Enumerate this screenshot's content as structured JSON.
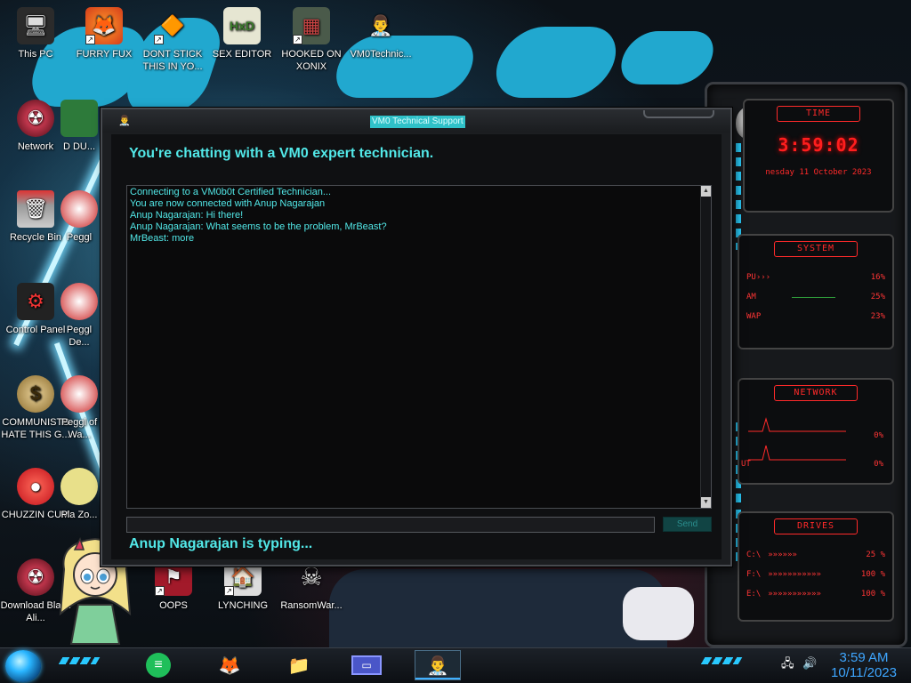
{
  "desktop": {
    "icons": [
      {
        "label": "This PC",
        "glyph": "🖥"
      },
      {
        "label": "FURRY FUX",
        "glyph": "🦊"
      },
      {
        "label": "DONT STICK THIS IN YO...",
        "glyph": "🔶"
      },
      {
        "label": "SEX EDITOR",
        "glyph": "HxD"
      },
      {
        "label": "HOOKED ON XONIX",
        "glyph": "▦"
      },
      {
        "label": "VM0Technic...",
        "glyph": "👨‍⚕️"
      },
      {
        "label": "Network",
        "glyph": "☢"
      },
      {
        "label": "D DU...",
        "glyph": ""
      },
      {
        "label": "Recycle Bin",
        "glyph": "🗑"
      },
      {
        "label": "Peggl",
        "glyph": ""
      },
      {
        "label": "Control Panel",
        "glyph": "⚙"
      },
      {
        "label": "Peggl De...",
        "glyph": ""
      },
      {
        "label": "COMMUNISTS HATE THIS G...",
        "glyph": "$"
      },
      {
        "label": "Peggl of Wa...",
        "glyph": ""
      },
      {
        "label": "CHUZZIN CUM",
        "glyph": "●"
      },
      {
        "label": "Pla Zo...",
        "glyph": ""
      },
      {
        "label": "Download Black Ali...",
        "glyph": "☢"
      },
      {
        "label": "OOPS",
        "glyph": "⚑"
      },
      {
        "label": "LYNCHING",
        "glyph": "🏠"
      },
      {
        "label": "RansomWar...",
        "glyph": "☠"
      }
    ]
  },
  "gadget": {
    "time_header": "TIME",
    "time": "3:59:02",
    "date": "nesday 11 October 2023",
    "system_header": "SYSTEM",
    "cpu_label": "PU",
    "cpu_value": "16%",
    "ram_label": "AM",
    "ram_value": "25%",
    "swap_label": "WAP",
    "swap_value": "23%",
    "network_header": "NETWORK",
    "net_in_value": "0%",
    "net_out_label": "UT",
    "net_out_value": "0%",
    "drives_header": "DRIVES",
    "drive1_label": "C:\\",
    "drive1_value": "25 %",
    "drive2_label": "F:\\",
    "drive2_value": "100 %",
    "drive3_label": "E:\\",
    "drive3_value": "100 %"
  },
  "chat": {
    "title": "VM0 Technical Support",
    "heading": "You're chatting with a VM0 expert technician.",
    "messages": [
      "Connecting to a VM0b0t Certified Technician...",
      "You are now connected with Anup Nagarajan",
      "Anup Nagarajan: Hi there!",
      "Anup Nagarajan: What seems to be the problem, MrBeast?",
      "MrBeast: more"
    ],
    "input_value": "",
    "send_label": "Send",
    "typing_status": "Anup Nagarajan is typing..."
  },
  "taskbar": {
    "apps": [
      {
        "name": "notes-app",
        "glyph": "≡",
        "active": false
      },
      {
        "name": "firefox",
        "glyph": "🦊",
        "active": false
      },
      {
        "name": "file-explorer",
        "glyph": "📁",
        "active": false
      },
      {
        "name": "vm-app",
        "glyph": "▭",
        "active": false
      },
      {
        "name": "vm0-technician",
        "glyph": "👨‍⚕️",
        "active": true
      }
    ],
    "clock_time": "3:59 AM",
    "clock_date": "10/11/2023"
  },
  "colors": {
    "chat_accent": "#52e8e8",
    "gadget_red": "#ff2a2a",
    "taskbar_clock": "#3ea6ff"
  }
}
